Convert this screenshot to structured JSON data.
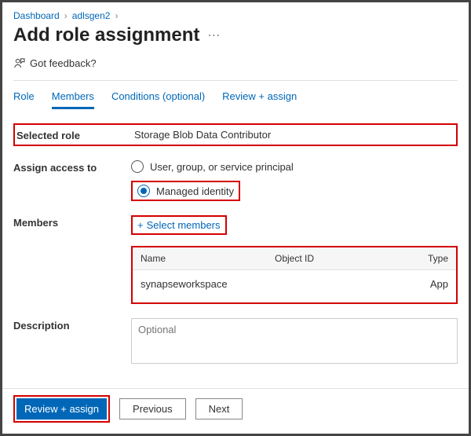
{
  "breadcrumb": {
    "item1": "Dashboard",
    "item2": "adlsgen2"
  },
  "title": "Add role assignment",
  "feedback": "Got feedback?",
  "tabs": {
    "role": "Role",
    "members": "Members",
    "conditions": "Conditions (optional)",
    "review": "Review + assign"
  },
  "selected_role": {
    "label": "Selected role",
    "value": "Storage Blob Data Contributor"
  },
  "assign": {
    "label": "Assign access to",
    "opt1": "User, group, or service principal",
    "opt2": "Managed identity"
  },
  "members": {
    "label": "Members",
    "select": "Select members"
  },
  "table": {
    "headers": {
      "name": "Name",
      "object_id": "Object ID",
      "type": "Type"
    },
    "row": {
      "name": "synapseworkspace",
      "object_id": "",
      "type": "App"
    }
  },
  "description": {
    "label": "Description",
    "placeholder": "Optional"
  },
  "footer": {
    "review": "Review + assign",
    "previous": "Previous",
    "next": "Next"
  }
}
